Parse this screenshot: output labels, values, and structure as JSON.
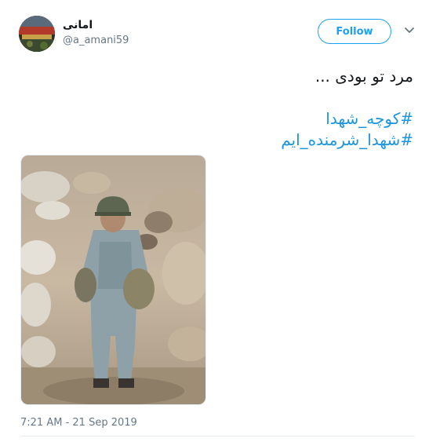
{
  "author": {
    "display_name": "امانی",
    "handle": "@a_amani59"
  },
  "actions": {
    "follow_label": "Follow"
  },
  "tweet": {
    "text": "مرد تو بودی ...",
    "hashtags": [
      "#کوچه_شهدا",
      "#شهدا_شرمنده_ایم"
    ],
    "timestamp": "7:21 AM - 21 Sep 2019"
  },
  "icons": {
    "menu": "chevron-down-icon"
  },
  "colors": {
    "accent": "#1da1f2",
    "hashtag": "#1b95e0",
    "secondary_text": "#657786",
    "divider": "#e6ecf0"
  }
}
